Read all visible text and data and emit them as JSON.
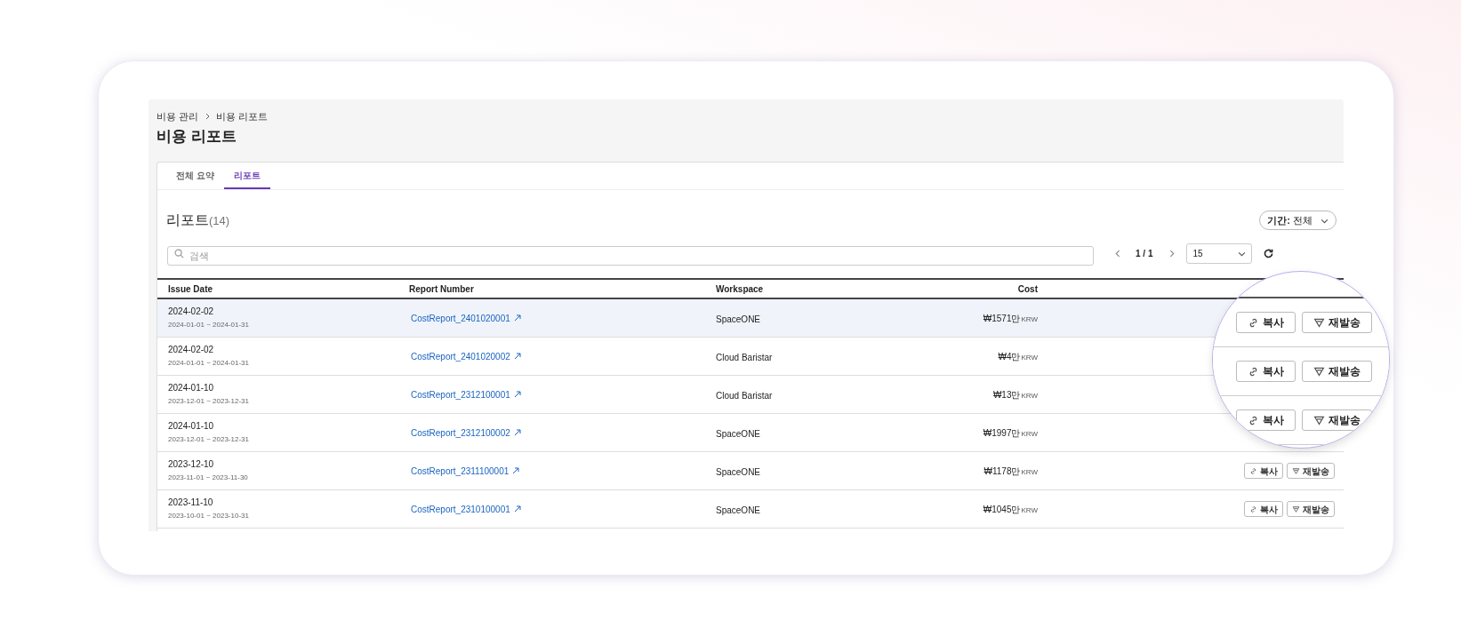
{
  "breadcrumbs": [
    {
      "label": "비용 관리"
    },
    {
      "label": "비용 리포트"
    }
  ],
  "page_title": "비용 리포트",
  "tabs": [
    {
      "label": "전체 요약",
      "selected": false
    },
    {
      "label": "리포트",
      "selected": true
    }
  ],
  "section": {
    "title": "리포트",
    "count": "(14)"
  },
  "period_filter": {
    "label": "기간:",
    "value": "전체"
  },
  "search": {
    "placeholder": "검색"
  },
  "pagination": {
    "page": "1 / 1",
    "page_size": "15"
  },
  "table": {
    "columns": [
      "Issue Date",
      "Report Number",
      "Workspace",
      "Cost"
    ],
    "rows": [
      {
        "issue_date": "2024-02-02",
        "period": "2024-01-01 ~ 2024-01-31",
        "report_number": "CostReport_2401020001",
        "workspace": "SpaceONE",
        "cost": "₩1571만",
        "currency": "KRW",
        "selected": true
      },
      {
        "issue_date": "2024-02-02",
        "period": "2024-01-01 ~ 2024-01-31",
        "report_number": "CostReport_2401020002",
        "workspace": "Cloud Baristar",
        "cost": "₩4만",
        "currency": "KRW",
        "selected": false
      },
      {
        "issue_date": "2024-01-10",
        "period": "2023-12-01 ~ 2023-12-31",
        "report_number": "CostReport_2312100001",
        "workspace": "Cloud Baristar",
        "cost": "₩13만",
        "currency": "KRW",
        "selected": false
      },
      {
        "issue_date": "2024-01-10",
        "period": "2023-12-01 ~ 2023-12-31",
        "report_number": "CostReport_2312100002",
        "workspace": "SpaceONE",
        "cost": "₩1997만",
        "currency": "KRW",
        "selected": false
      },
      {
        "issue_date": "2023-12-10",
        "period": "2023-11-01 ~ 2023-11-30",
        "report_number": "CostReport_2311100001",
        "workspace": "SpaceONE",
        "cost": "₩1178만",
        "currency": "KRW",
        "selected": false,
        "copy": "복사",
        "resend": "재발송"
      },
      {
        "issue_date": "2023-11-10",
        "period": "2023-10-01 ~ 2023-10-31",
        "report_number": "CostReport_2310100001",
        "workspace": "SpaceONE",
        "cost": "₩1045만",
        "currency": "KRW",
        "selected": false,
        "copy": "복사",
        "resend": "재발송"
      }
    ]
  },
  "magnifier": {
    "rows": [
      {
        "copy": "복사",
        "resend": "재발송"
      },
      {
        "copy": "복사",
        "resend": "재발송"
      },
      {
        "copy": "복사",
        "resend": "재발송"
      }
    ]
  }
}
